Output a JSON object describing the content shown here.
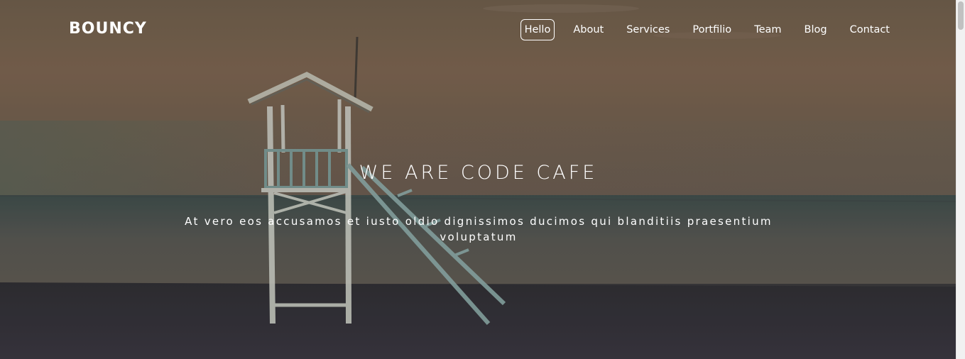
{
  "brand": {
    "logo_text": "BOUNCY"
  },
  "nav": {
    "items": [
      {
        "label": "Hello",
        "active": true
      },
      {
        "label": "About",
        "active": false
      },
      {
        "label": "Services",
        "active": false
      },
      {
        "label": "Portfilio",
        "active": false
      },
      {
        "label": "Team",
        "active": false
      },
      {
        "label": "Blog",
        "active": false
      },
      {
        "label": "Contact",
        "active": false
      }
    ]
  },
  "hero": {
    "headline": "WE ARE CODE CAFE",
    "tagline": "At vero eos accusamos et iusto oldio dignissimos ducimos qui blanditiis praesentium voluptatum",
    "background_image": "lifeguard-tower-on-beach-at-dusk"
  },
  "colors": {
    "sky_top": "#7a6552",
    "sky_bottom": "#6b5a4c",
    "sea": "#4e5a57",
    "sand": "#34323a",
    "text": "#ffffff"
  }
}
